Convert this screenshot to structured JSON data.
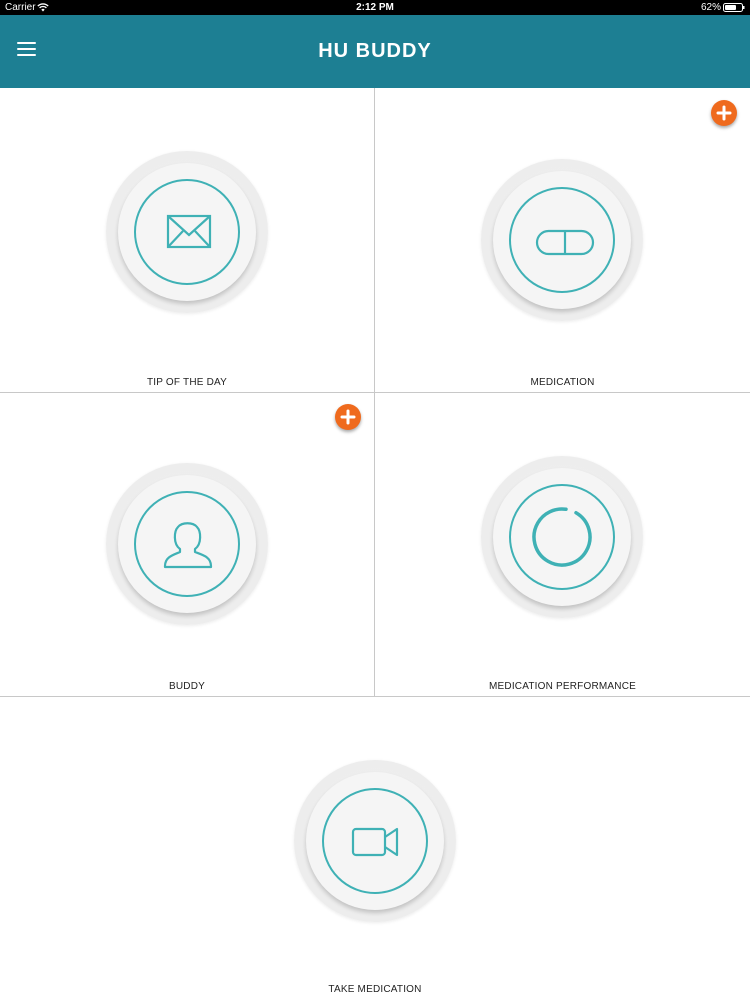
{
  "status_bar": {
    "carrier": "Carrier",
    "time": "2:12 PM",
    "battery_percent": "62%",
    "wifi_icon": "wifi-icon",
    "battery_icon": "battery-icon"
  },
  "header": {
    "title": "HU BUDDY",
    "menu_icon": "hamburger-menu-icon",
    "background_color": "#1d7f93"
  },
  "tiles": [
    {
      "label": "TIP OF THE DAY",
      "icon": "envelope-icon",
      "has_add_button": false
    },
    {
      "label": "MEDICATION",
      "icon": "pill-icon",
      "has_add_button": true
    },
    {
      "label": "BUDDY",
      "icon": "person-icon",
      "has_add_button": true
    },
    {
      "label": "MEDICATION PERFORMANCE",
      "icon": "progress-ring-icon",
      "has_add_button": false
    },
    {
      "label": "TAKE MEDICATION",
      "icon": "video-camera-icon",
      "has_add_button": false
    }
  ],
  "colors": {
    "accent_teal": "#3fb1b5",
    "add_button_orange": "#ef6a1d"
  }
}
